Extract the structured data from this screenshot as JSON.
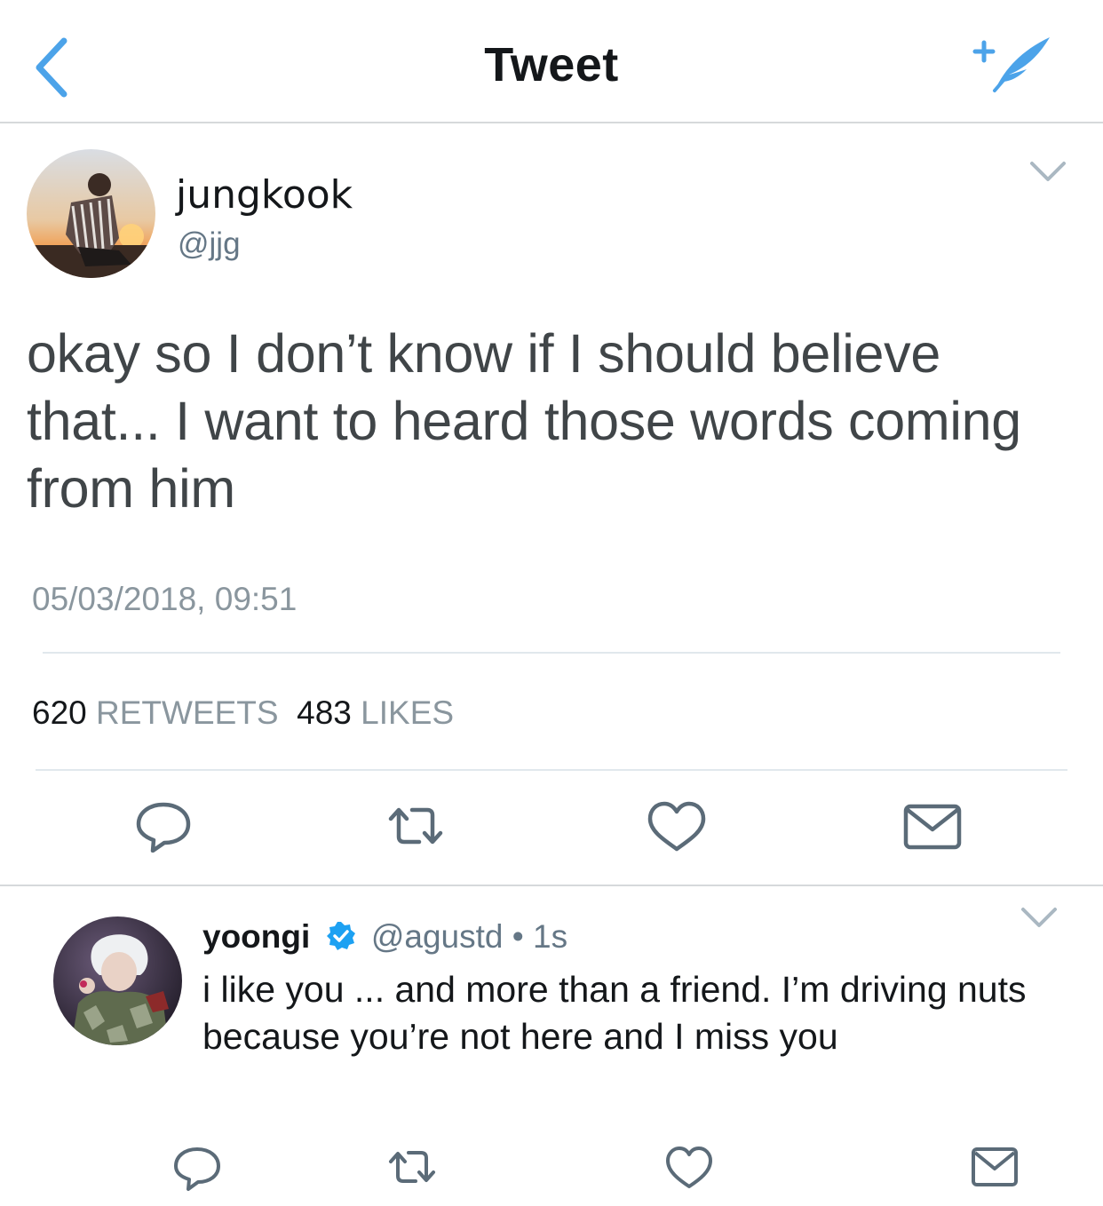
{
  "colors": {
    "accent": "#4ca3e9",
    "text_primary": "#14171a",
    "text_secondary": "#657786",
    "divider": "#e1e8ed"
  },
  "nav": {
    "title": "Tweet",
    "back_icon": "chevron-left-icon",
    "compose_icon": "compose-tweet-icon"
  },
  "tweet": {
    "author_name": "jungkook",
    "author_handle": "@jjg",
    "text": "okay so I don’t know if I should believe that... I want to heard those words coming from him",
    "timestamp": "05/03/2018, 09:51",
    "retweets_count": "620",
    "retweets_label": "RETWEETS",
    "likes_count": "483",
    "likes_label": "LIKES",
    "actions": [
      "reply-icon",
      "retweet-icon",
      "like-icon",
      "direct-message-icon"
    ]
  },
  "reply": {
    "author_name": "yoongi",
    "author_handle": "@agustd",
    "separator": "•",
    "time": "1s",
    "verified": true,
    "text": "i like you ... and more than a friend. I’m driving nuts because you’re not here and I miss you",
    "actions": [
      "reply-icon",
      "retweet-icon",
      "like-icon",
      "direct-message-icon"
    ]
  }
}
